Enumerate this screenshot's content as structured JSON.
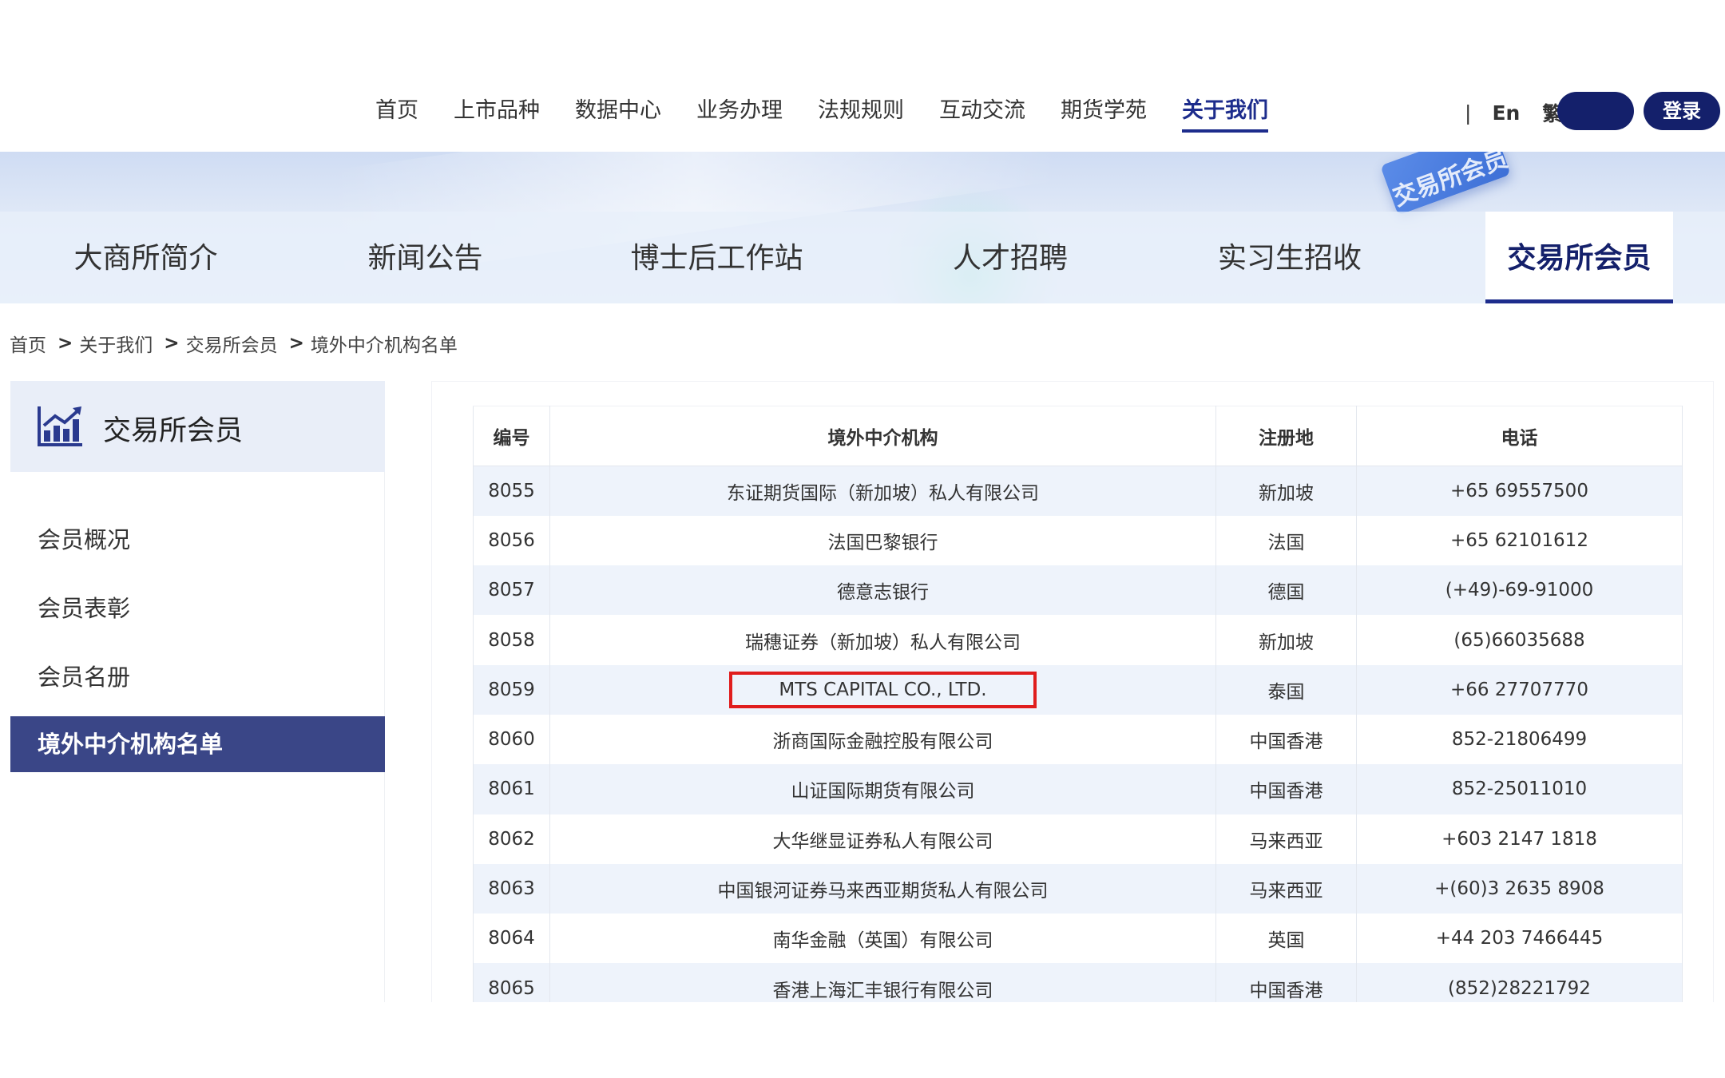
{
  "header": {
    "menu": [
      "首页",
      "上市品种",
      "数据中心",
      "业务办理",
      "法规规则",
      "互动交流",
      "期货学苑",
      "关于我们"
    ],
    "active_menu": "关于我们",
    "lang_en": "En",
    "lang_trad": "繁",
    "separator": "|",
    "blank_button": "",
    "login_button": "登录"
  },
  "banner": {
    "stamp_text": "交易所会员",
    "tabs": [
      "大商所简介",
      "新闻公告",
      "博士后工作站",
      "人才招聘",
      "实习生招收",
      "交易所会员"
    ],
    "active_tab": "交易所会员"
  },
  "breadcrumb": {
    "items": [
      "首页",
      "关于我们",
      "交易所会员",
      "境外中介机构名单"
    ],
    "separator": ">"
  },
  "sidebar": {
    "title": "交易所会员",
    "items": [
      "会员概况",
      "会员表彰",
      "会员名册",
      "境外中介机构名单"
    ],
    "active_item": "境外中介机构名单"
  },
  "table": {
    "headers": [
      "编号",
      "境外中介机构",
      "注册地",
      "电话"
    ],
    "rows": [
      [
        "8055",
        "东证期货国际（新加坡）私人有限公司",
        "新加坡",
        "+65 69557500"
      ],
      [
        "8056",
        "法国巴黎银行",
        "法国",
        "+65 62101612"
      ],
      [
        "8057",
        "德意志银行",
        "德国",
        "(+49)-69-91000"
      ],
      [
        "8058",
        "瑞穗证券（新加坡）私人有限公司",
        "新加坡",
        "(65)66035688"
      ],
      [
        "8059",
        "MTS CAPITAL CO., LTD.",
        "泰国",
        "+66 27707770"
      ],
      [
        "8060",
        "浙商国际金融控股有限公司",
        "中国香港",
        "852-21806499"
      ],
      [
        "8061",
        "山证国际期货有限公司",
        "中国香港",
        "852-25011010"
      ],
      [
        "8062",
        "大华继显证券私人有限公司",
        "马来西亚",
        "+603 2147 1818"
      ],
      [
        "8063",
        "中国银河证券马来西亚期货私人有限公司",
        "马来西亚",
        "+(60)3 2635 8908"
      ],
      [
        "8064",
        "南华金融（英国）有限公司",
        "英国",
        "+44 203 7466445"
      ],
      [
        "8065",
        "香港上海汇丰银行有限公司",
        "中国香港",
        "(852)28221792"
      ]
    ],
    "highlighted_row": "8059"
  },
  "colors": {
    "brand_navy": "#14206b",
    "active_blue": "#1d2c8c",
    "sidebar_active": "#3a4687",
    "highlight_red": "#e01d1d",
    "row_stripe": "#eef3fb"
  }
}
